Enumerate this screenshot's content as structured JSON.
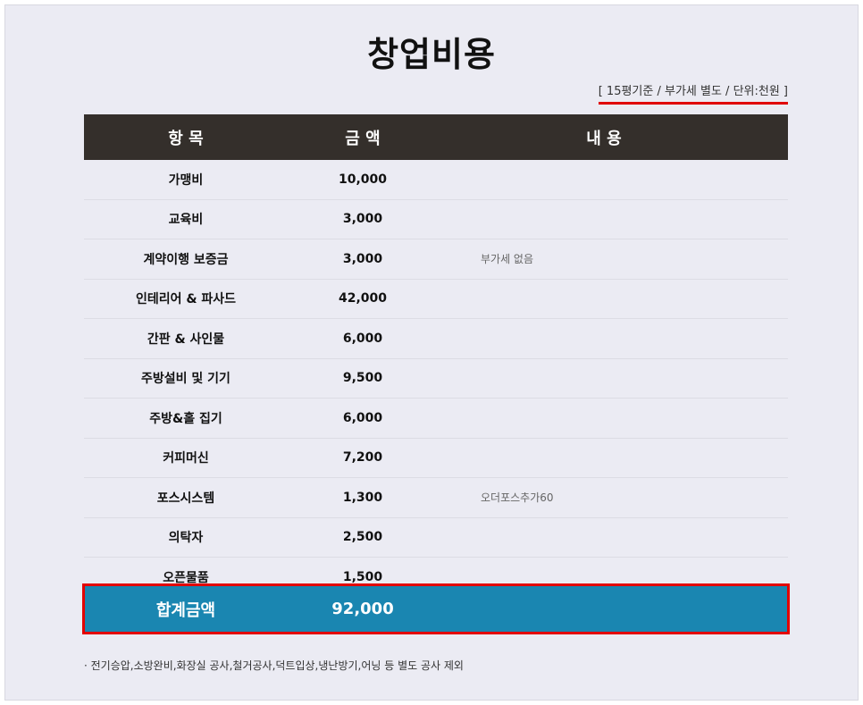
{
  "title": "창업비용",
  "note": "[ 15평기준 / 부가세 별도 / 단위:천원 ]",
  "headers": {
    "item": "항 목",
    "amount": "금 액",
    "content": "내 용"
  },
  "rows": [
    {
      "item": "가맹비",
      "amount": "10,000",
      "content": ""
    },
    {
      "item": "교육비",
      "amount": "3,000",
      "content": ""
    },
    {
      "item": "계약이행 보증금",
      "amount": "3,000",
      "content": "부가세 없음"
    },
    {
      "item": "인테리어 & 파사드",
      "amount": "42,000",
      "content": ""
    },
    {
      "item": "간판 & 사인물",
      "amount": "6,000",
      "content": ""
    },
    {
      "item": "주방설비 및 기기",
      "amount": "9,500",
      "content": ""
    },
    {
      "item": "주방&홀 집기",
      "amount": "6,000",
      "content": ""
    },
    {
      "item": "커피머신",
      "amount": "7,200",
      "content": ""
    },
    {
      "item": "포스시스템",
      "amount": "1,300",
      "content": "오더포스추가60"
    },
    {
      "item": "의탁자",
      "amount": "2,500",
      "content": ""
    },
    {
      "item": "오픈물품",
      "amount": "1,500",
      "content": ""
    }
  ],
  "total": {
    "label": "합계금액",
    "amount": "92,000"
  },
  "footnote": "· 전기승압,소방완비,화장실 공사,철거공사,덕트입상,냉난방기,어닝 등 별도 공사 제외",
  "colors": {
    "header_bg": "#342f2b",
    "total_bg": "#1a86b1",
    "highlight": "#e30000",
    "page_bg": "#ebebf3"
  }
}
